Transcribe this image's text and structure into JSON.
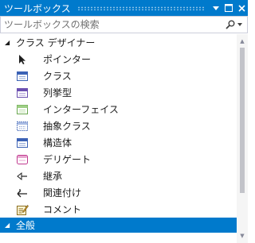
{
  "window": {
    "title": "ツールボックス"
  },
  "search": {
    "placeholder": "ツールボックスの検索"
  },
  "group": {
    "label": "クラス デザイナー",
    "items": [
      {
        "label": "ポインター",
        "icon": "pointer-icon"
      },
      {
        "label": "クラス",
        "icon": "class-icon"
      },
      {
        "label": "列挙型",
        "icon": "enum-icon"
      },
      {
        "label": "インターフェイス",
        "icon": "interface-icon"
      },
      {
        "label": "抽象クラス",
        "icon": "abstract-class-icon"
      },
      {
        "label": "構造体",
        "icon": "struct-icon"
      },
      {
        "label": "デリゲート",
        "icon": "delegate-icon"
      },
      {
        "label": "継承",
        "icon": "inheritance-icon"
      },
      {
        "label": "関連付け",
        "icon": "association-icon"
      },
      {
        "label": "コメント",
        "icon": "comment-icon"
      }
    ]
  },
  "general_group": {
    "label": "全般"
  },
  "colors": {
    "accent": "#007acc",
    "class": "#3b62b5",
    "enum": "#6b4fb0",
    "interface": "#6aa84f",
    "delegate": "#c0398f"
  }
}
